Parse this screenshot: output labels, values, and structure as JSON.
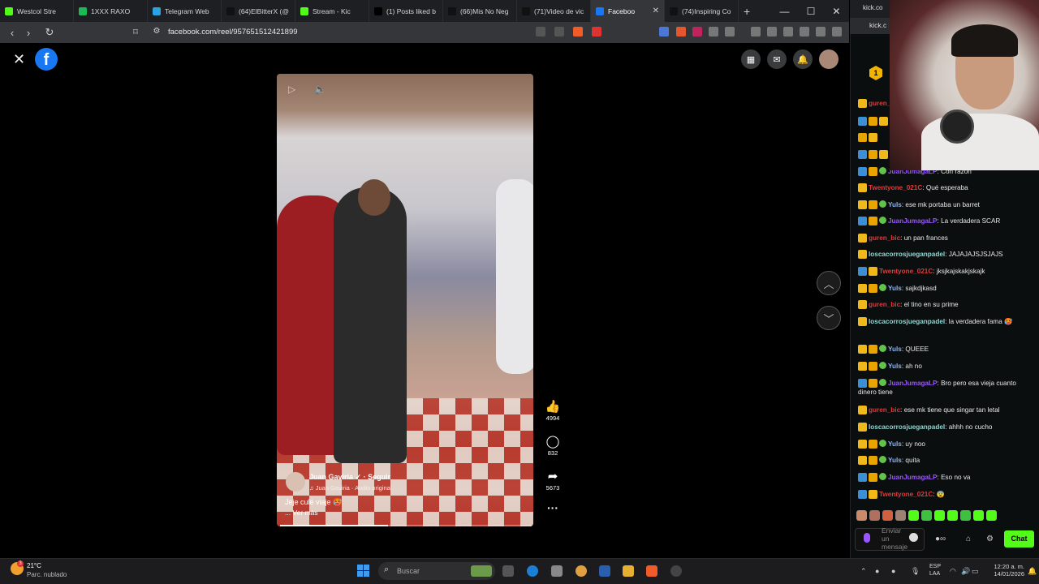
{
  "browser": {
    "tabs": [
      {
        "title": "Westcol Stre",
        "icon": "kick-icon",
        "color": "#53fc18"
      },
      {
        "title": "1XXX RAXO",
        "icon": "spotify-icon",
        "color": "#1db954"
      },
      {
        "title": "Telegram Web",
        "icon": "telegram-icon",
        "color": "#2aa3df"
      },
      {
        "title": "(64)ElBitterX (@",
        "icon": "tiktok-icon",
        "color": "#111111"
      },
      {
        "title": "Stream - Kic",
        "icon": "kick-icon",
        "color": "#53fc18"
      },
      {
        "title": "(1) Posts liked b",
        "icon": "x-icon",
        "color": "#000000"
      },
      {
        "title": "(66)Mis No Neg",
        "icon": "tiktok-icon",
        "color": "#111111"
      },
      {
        "title": "(71)Video de vic",
        "icon": "tiktok-icon",
        "color": "#111111"
      },
      {
        "title": "Faceboo",
        "icon": "facebook-icon",
        "color": "#1877f2"
      },
      {
        "title": "(74)Inspiring Co",
        "icon": "tiktok-icon",
        "color": "#111111"
      }
    ],
    "url": "facebook.com/reel/957651512421899"
  },
  "facebook": {
    "logo": "f",
    "reel": {
      "author": "Juan Gaviria ✓ · Seguir",
      "audio": "♫ Juan Gaviria · Audio original",
      "caption": "Jeje culé viaje 🥵",
      "see_more": "... Ver más",
      "progress": 0.43,
      "likes": "4994",
      "comments": "832",
      "shares": "5673"
    }
  },
  "kick": {
    "tab_title": "kick.co",
    "addr": "kick.c",
    "top_badge": "1",
    "messages": [
      {
        "user": "guren_",
        "color": "#e03a3a",
        "text": "",
        "badges": [
          "crown"
        ]
      },
      {
        "user": "",
        "color": "#e8e8e8",
        "text": "",
        "badges": [
          "blue",
          "gold",
          "crown"
        ]
      },
      {
        "user": "",
        "color": "#e8e8e8",
        "text": "",
        "badges": [
          "gold",
          "crown"
        ]
      },
      {
        "user": "Tw",
        "color": "#e03a3a",
        "text": "",
        "badges": [
          "blue",
          "gold",
          "crown"
        ]
      },
      {
        "user": "JuanJumagaLP",
        "color": "#9b55ff",
        "text": ": Con razón",
        "badges": [
          "blue",
          "gold",
          "green"
        ]
      },
      {
        "user": "Twentyone_021C",
        "color": "#e03a3a",
        "text": ": Qué esperaba",
        "badges": [
          "crown"
        ]
      },
      {
        "user": "Yuls",
        "color": "#8fb4f0",
        "text": ": ese mk portaba un barret",
        "badges": [
          "crown",
          "gold",
          "green"
        ]
      },
      {
        "user": "JuanJumagaLP",
        "color": "#9b55ff",
        "text": ": La verdadera SCAR",
        "badges": [
          "blue",
          "gold",
          "green"
        ]
      },
      {
        "user": "guren_bic",
        "color": "#e03a3a",
        "text": ": un pan frances",
        "badges": [
          "crown"
        ]
      },
      {
        "user": "loscacorrosjueganpadel",
        "color": "#8fd7d0",
        "text": ": JAJAJAJSJSJAJS",
        "badges": [
          "crown"
        ]
      },
      {
        "user": "Twentyone_021C",
        "color": "#e03a3a",
        "text": ": jksjkajskakjskajk",
        "badges": [
          "blue",
          "crown"
        ]
      },
      {
        "user": "Yuls",
        "color": "#8fb4f0",
        "text": ": sajkdjkasd",
        "badges": [
          "crown",
          "gold",
          "green"
        ]
      },
      {
        "user": "guren_bic",
        "color": "#e03a3a",
        "text": ": el tino en su prime",
        "badges": [
          "crown"
        ]
      },
      {
        "user": "loscacorrosjueganpadel",
        "color": "#8fd7d0",
        "text": ": la verdadera fama 🥵",
        "badges": [
          "crown"
        ]
      },
      {
        "user": "Yuls",
        "color": "#8fb4f0",
        "text": ": QUEEE",
        "badges": [
          "crown",
          "gold",
          "green"
        ]
      },
      {
        "user": "Yuls",
        "color": "#8fb4f0",
        "text": ": ah no",
        "badges": [
          "crown",
          "gold",
          "green"
        ]
      },
      {
        "user": "JuanJumagaLP",
        "color": "#9b55ff",
        "text": ": Bro pero esa vieja cuanto dinero tiene",
        "badges": [
          "blue",
          "gold",
          "green"
        ]
      },
      {
        "user": "guren_bic",
        "color": "#e03a3a",
        "text": ": ese mk tiene que singar tan letal",
        "badges": [
          "crown"
        ]
      },
      {
        "user": "loscacorrosjueganpadel",
        "color": "#8fd7d0",
        "text": ": ahhh no cucho",
        "badges": [
          "crown"
        ]
      },
      {
        "user": "Yuls",
        "color": "#8fb4f0",
        "text": ": uy noo",
        "badges": [
          "crown",
          "gold",
          "green"
        ]
      },
      {
        "user": "Yuls",
        "color": "#8fb4f0",
        "text": ": quita",
        "badges": [
          "crown",
          "gold",
          "green"
        ]
      },
      {
        "user": "JuanJumagaLP",
        "color": "#9b55ff",
        "text": ": Eso no va",
        "badges": [
          "blue",
          "gold",
          "green"
        ]
      },
      {
        "user": "Twentyone_021C",
        "color": "#e03a3a",
        "text": ": 😨",
        "badges": [
          "blue",
          "crown"
        ]
      }
    ],
    "input_placeholder": "Enviar un mensaje",
    "chat_button": "Chat"
  },
  "taskbar": {
    "weather_temp": "21°C",
    "weather_desc": "Parc. nublado",
    "weather_badge": "3",
    "search_placeholder": "Buscar",
    "lang1": "ESP",
    "lang2": "LAA",
    "time": "12:20 a. m.",
    "date": "14/01/2026"
  }
}
